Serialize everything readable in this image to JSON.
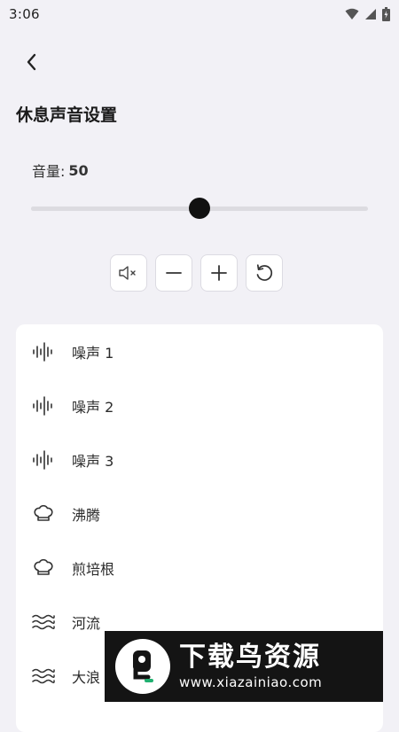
{
  "status_bar": {
    "time": "3:06"
  },
  "page": {
    "title": "休息声音设置"
  },
  "volume": {
    "label": "音量:",
    "value": "50",
    "level": 0.5
  },
  "controls": [
    {
      "name": "mute-button",
      "icon": "speaker-mute-icon"
    },
    {
      "name": "volume-down-button",
      "icon": "minus-icon"
    },
    {
      "name": "volume-up-button",
      "icon": "plus-icon"
    },
    {
      "name": "reset-button",
      "icon": "refresh-icon"
    }
  ],
  "sounds": [
    {
      "label": "噪声 1",
      "icon": "waveform-icon"
    },
    {
      "label": "噪声 2",
      "icon": "waveform-icon"
    },
    {
      "label": "噪声 3",
      "icon": "waveform-icon"
    },
    {
      "label": "沸腾",
      "icon": "chef-hat-icon"
    },
    {
      "label": "煎培根",
      "icon": "chef-hat-icon"
    },
    {
      "label": "河流",
      "icon": "waves-icon"
    },
    {
      "label": "大浪",
      "icon": "waves-icon"
    }
  ],
  "watermark": {
    "title": "下载鸟资源",
    "url": "www.xiazainiao.com"
  }
}
